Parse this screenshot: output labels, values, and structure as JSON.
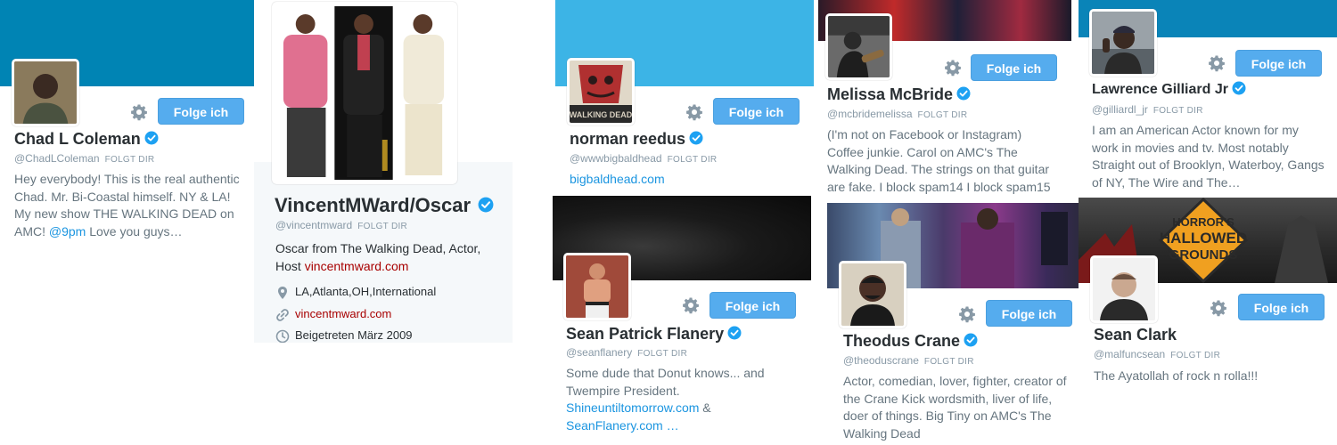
{
  "common": {
    "follow_label": "Folge ich",
    "follows_you": "FOLGT DIR"
  },
  "cards": {
    "chad": {
      "name": "Chad L Coleman",
      "handle": "@ChadLColeman",
      "bio_text": "Hey everybody! This is the real authentic Chad. Mr. Bi-Coastal himself. NY & LA! My new show THE WALKING DEAD on AMC! ",
      "bio_link": "@9pm",
      "bio_tail": " Love you guys…"
    },
    "vincent": {
      "name": "VincentMWard/Oscar",
      "handle": "@vincentmward",
      "bio_text": "Oscar from The Walking Dead, Actor, Host ",
      "bio_link": "vincentmward.com",
      "location": "LA,Atlanta,OH,International",
      "website": "vincentmward.com",
      "joined": "Beigetreten März 2009"
    },
    "norman": {
      "name": "norman reedus",
      "handle": "@wwwbigbaldhead",
      "website": "bigbaldhead.com",
      "avatar_text": "WALKING DEAD"
    },
    "melissa": {
      "name": "Melissa McBride",
      "handle": "@mcbridemelissa",
      "bio": "(I'm not on Facebook or Instagram) Coffee junkie. Carol on AMC's The Walking Dead. The strings on that guitar are fake. I block spam14 I block spam15"
    },
    "lawrence": {
      "name": "Lawrence Gilliard Jr",
      "handle": "@gilliardl_jr",
      "bio": "I am an American Actor known for my work in movies and tv. Most notably Straight out of Brooklyn, Waterboy, Gangs of NY, The Wire and The…"
    },
    "sean_f": {
      "name": "Sean Patrick Flanery",
      "handle": "@seanflanery",
      "bio_text": "Some dude that Donut knows... and Twempire President.",
      "link1": "Shineuntiltomorrow.com",
      "amp": " & ",
      "link2": "SeanFlanery.com",
      "ellipsis": " …"
    },
    "theodus": {
      "name": "Theodus Crane",
      "handle": "@theoduscrane",
      "bio": "Actor, comedian, lover, fighter, creator of the Crane Kick wordsmith, liver of life, doer of things. Big Tiny on AMC's The Walking Dead"
    },
    "sean_c": {
      "name": "Sean Clark",
      "handle": "@malfuncsean",
      "bio": "The Ayatollah of rock n rolla!!!",
      "banner_line1": "HORROR'S",
      "banner_line2": "HALLOWED",
      "banner_line3": "GROUNDS"
    }
  },
  "colors": {
    "twitter_blue": "#55acee",
    "banner_blue": "#0084b4",
    "banner_light": "#3cb4e6",
    "verified": "#1da1f2"
  }
}
